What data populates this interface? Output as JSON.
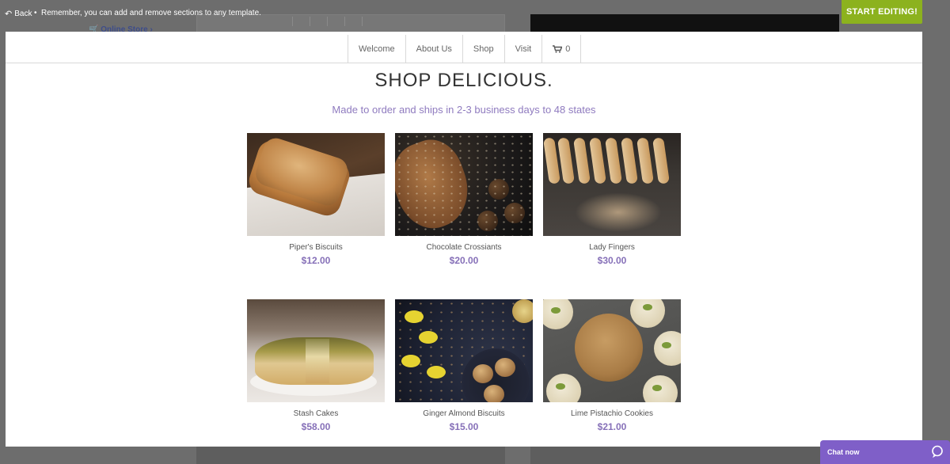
{
  "editor": {
    "back_label": "Back",
    "separator": "•",
    "hint": "Remember, you can add and remove sections to any template.",
    "start_editing_label": "START EDITING!",
    "background_store_link": "Online Store"
  },
  "nav": {
    "items": [
      "Welcome",
      "About Us",
      "Shop",
      "Visit"
    ],
    "cart_count": "0"
  },
  "shop": {
    "title": "SHOP DELICIOUS.",
    "subtitle": "Made to order and ships in 2-3 business days to 48 states",
    "products": [
      {
        "name": "Piper's Biscuits",
        "price": "$12.00"
      },
      {
        "name": "Chocolate Crossiants",
        "price": "$20.00"
      },
      {
        "name": "Lady Fingers",
        "price": "$30.00"
      },
      {
        "name": "Stash Cakes",
        "price": "$58.00"
      },
      {
        "name": "Ginger Almond Biscuits",
        "price": "$15.00"
      },
      {
        "name": "Lime Pistachio Cookies",
        "price": "$21.00"
      }
    ]
  },
  "chat": {
    "label": "Chat now"
  },
  "colors": {
    "accent_purple": "#8670b8",
    "start_button_green": "#8cb21e",
    "chat_purple": "#7f5fc8"
  }
}
